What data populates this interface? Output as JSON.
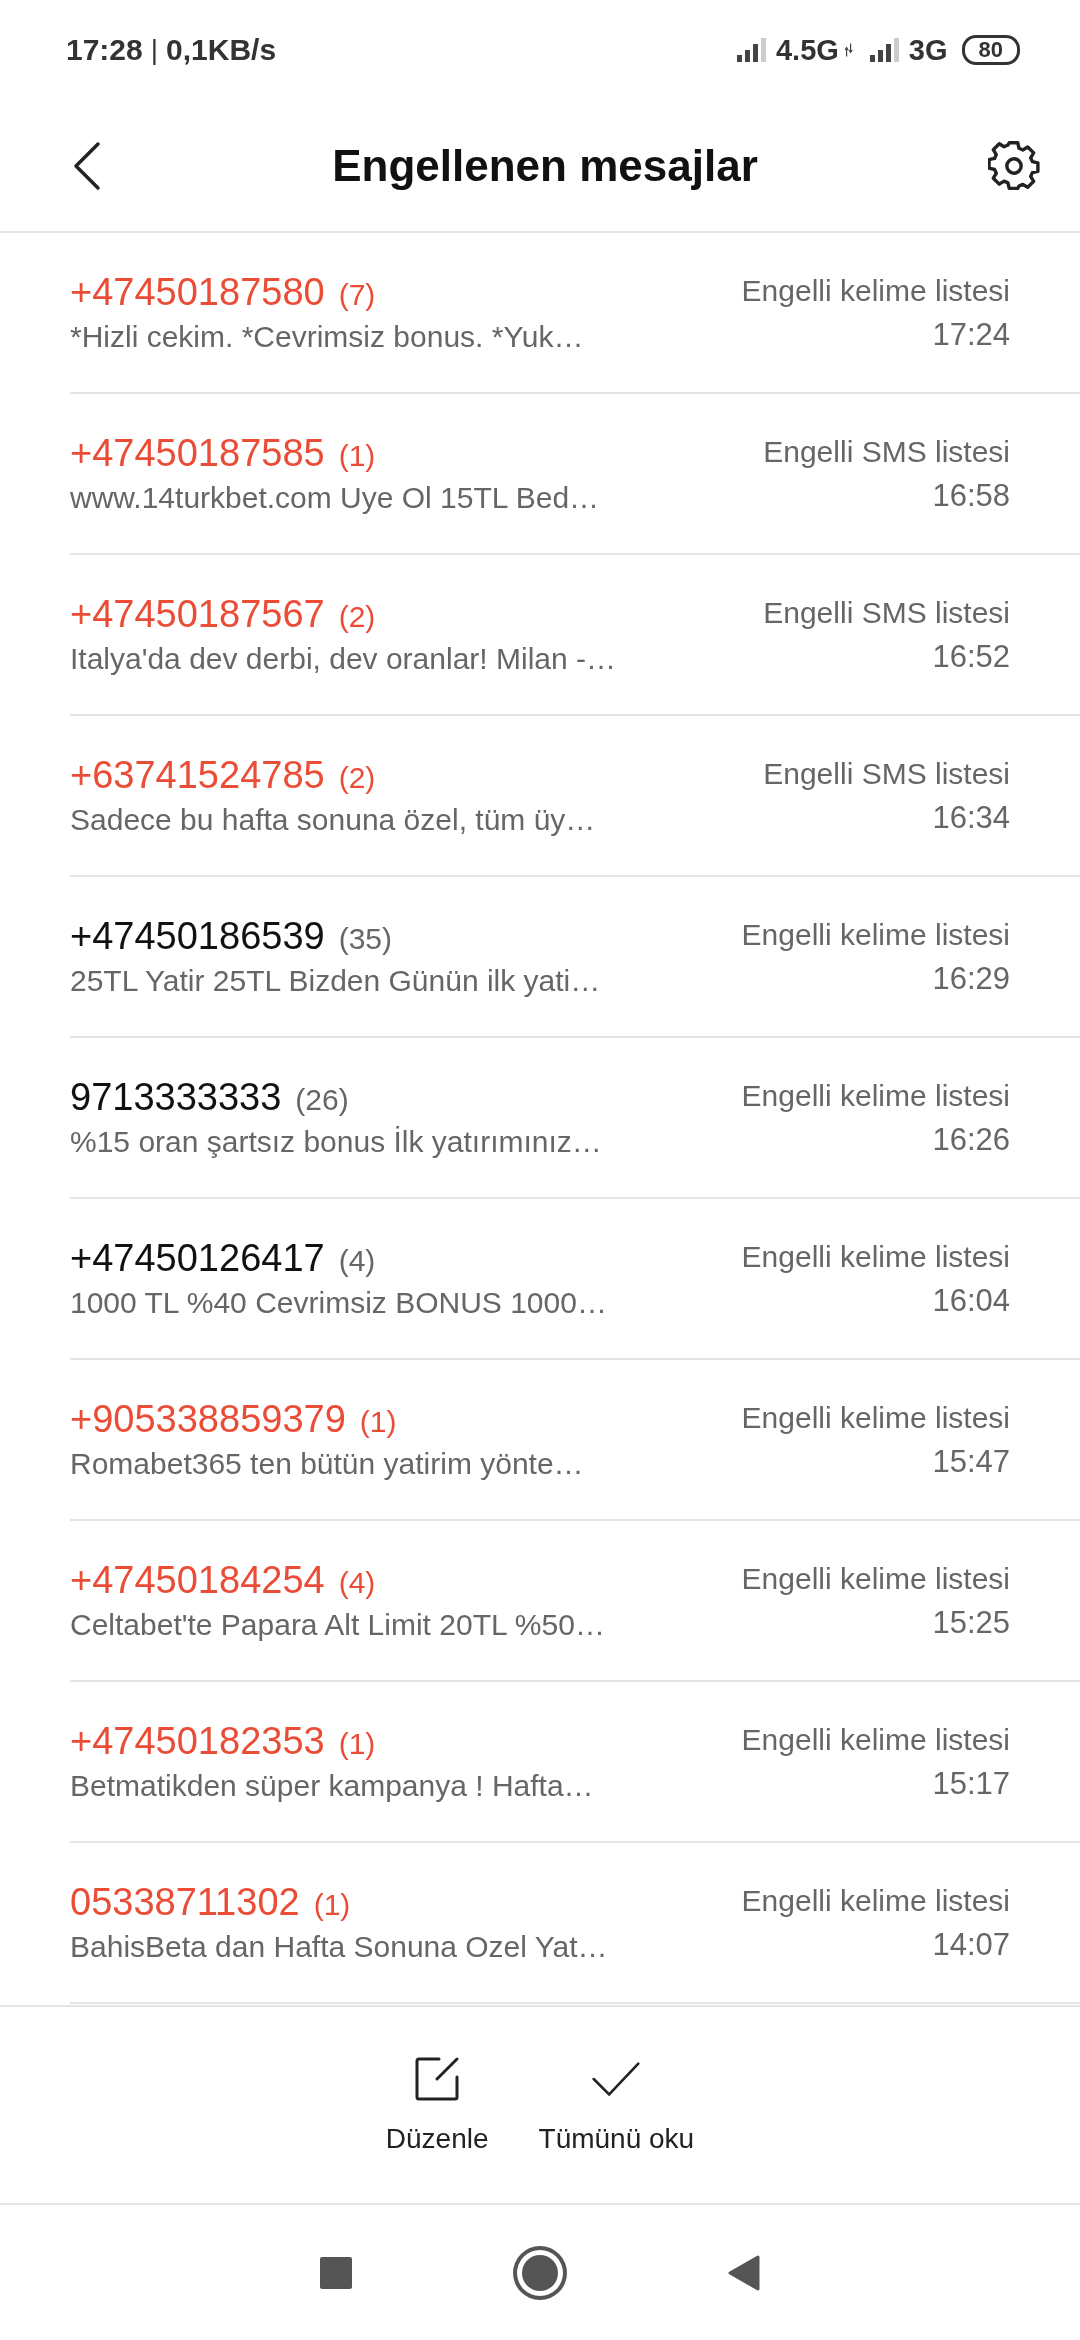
{
  "status_bar": {
    "time": "17:28",
    "separator": "|",
    "speed": "0,1KB/s",
    "network_1": "4.5G",
    "network_2": "3G",
    "battery": "80"
  },
  "header": {
    "title": "Engellenen mesajlar"
  },
  "messages": [
    {
      "sender": "+47450187580",
      "count": "(7)",
      "preview": "*Hizli cekim. *Cevrimsiz bonus. *Yuk…",
      "list": "Engelli kelime listesi",
      "time": "17:24",
      "unread": true
    },
    {
      "sender": "+47450187585",
      "count": "(1)",
      "preview": "www.14turkbet.com Uye Ol 15TL Bed…",
      "list": "Engelli SMS listesi",
      "time": "16:58",
      "unread": true
    },
    {
      "sender": "+47450187567",
      "count": "(2)",
      "preview": "Italya'da dev derbi, dev oranlar! Milan -…",
      "list": "Engelli SMS listesi",
      "time": "16:52",
      "unread": true
    },
    {
      "sender": "+63741524785",
      "count": "(2)",
      "preview": "Sadece bu hafta sonuna özel, tüm üy…",
      "list": "Engelli SMS listesi",
      "time": "16:34",
      "unread": true
    },
    {
      "sender": "+47450186539",
      "count": "(35)",
      "preview": "25TL Yatir 25TL Bizden Günün ilk yati…",
      "list": "Engelli kelime listesi",
      "time": "16:29",
      "unread": false
    },
    {
      "sender": "9713333333",
      "count": "(26)",
      "preview": "%15 oran şartsız bonus İlk yatırımınız…",
      "list": "Engelli kelime listesi",
      "time": "16:26",
      "unread": false
    },
    {
      "sender": "+47450126417",
      "count": "(4)",
      "preview": "1000 TL %40 Cevrimsiz BONUS  1000…",
      "list": "Engelli kelime listesi",
      "time": "16:04",
      "unread": false
    },
    {
      "sender": "+905338859379",
      "count": "(1)",
      "preview": "Romabet365 ten bütün yatirim yönte…",
      "list": "Engelli kelime listesi",
      "time": "15:47",
      "unread": true
    },
    {
      "sender": "+47450184254",
      "count": "(4)",
      "preview": "Celtabet'te Papara Alt Limit 20TL %50…",
      "list": "Engelli kelime listesi",
      "time": "15:25",
      "unread": true
    },
    {
      "sender": "+47450182353",
      "count": "(1)",
      "preview": "Betmatikden süper kampanya ! Hafta…",
      "list": "Engelli kelime listesi",
      "time": "15:17",
      "unread": true
    },
    {
      "sender": "05338711302",
      "count": "(1)",
      "preview": "BahisBeta dan Hafta Sonuna Ozel Yat…",
      "list": "Engelli kelime listesi",
      "time": "14:07",
      "unread": true
    }
  ],
  "actions": [
    {
      "kind": "edit",
      "label": "Düzenle"
    },
    {
      "kind": "read_all",
      "label": "Tümünü oku"
    }
  ]
}
